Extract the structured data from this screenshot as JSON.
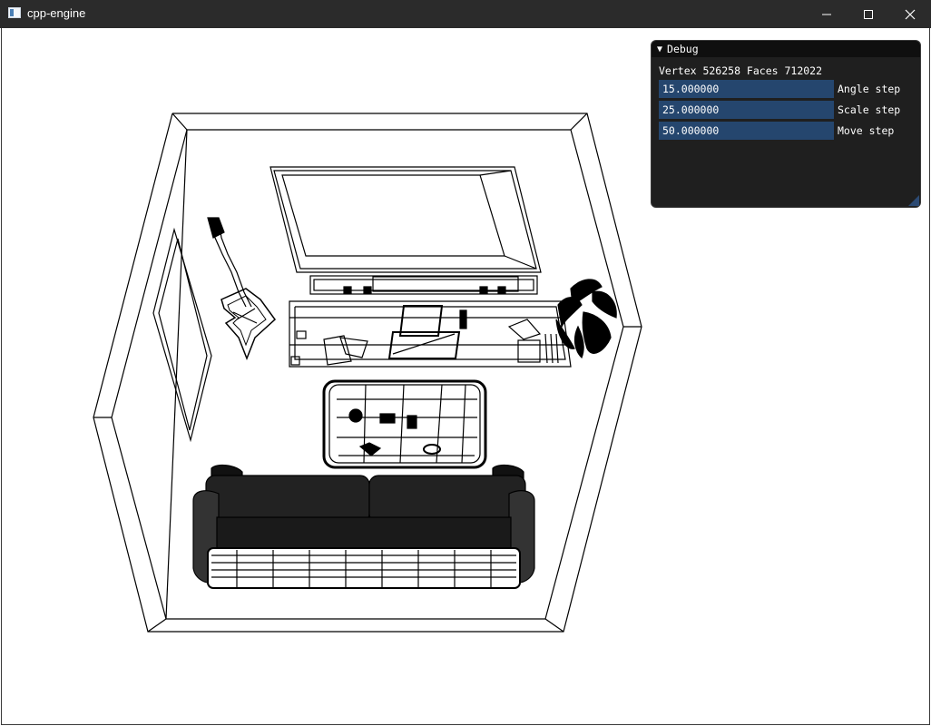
{
  "window": {
    "title": "cpp-engine"
  },
  "debug": {
    "title": "Debug",
    "stats": "Vertex 526258 Faces 712022",
    "fields": [
      {
        "value": "15.000000",
        "label": "Angle step"
      },
      {
        "value": "25.000000",
        "label": "Scale step"
      },
      {
        "value": "50.000000",
        "label": "Move step"
      }
    ]
  },
  "colors": {
    "titlebar": "#2b2b2b",
    "panel": "#1f1f1f",
    "field": "#25466e",
    "wire": "#000000"
  }
}
